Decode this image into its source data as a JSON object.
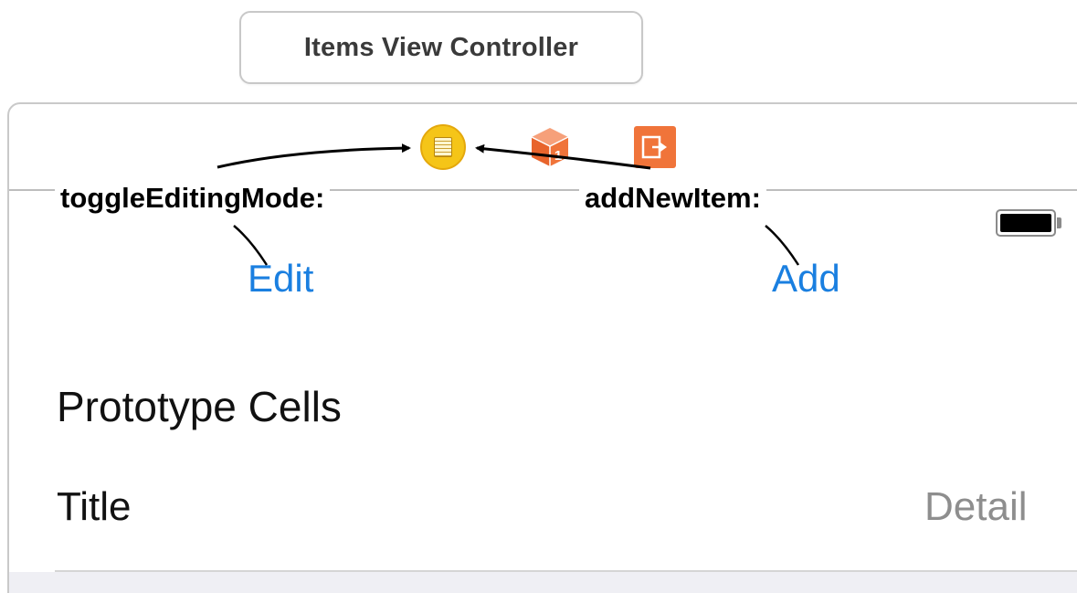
{
  "tooltip": {
    "text": "Items View Controller"
  },
  "scene_dock": {
    "icons": [
      "view-controller-icon",
      "first-responder-icon",
      "exit-icon"
    ],
    "colors": {
      "view_controller": "#f5c518",
      "first_responder": "#f0743a",
      "exit": "#f0743a"
    }
  },
  "connections": {
    "left_action": "toggleEditingMode:",
    "right_action": "addNewItem:"
  },
  "nav_bar": {
    "left_button": "Edit",
    "right_button": "Add",
    "tint_color": "#1a7fe0"
  },
  "status_bar": {
    "battery_icon": "battery-icon"
  },
  "table": {
    "section_header": "Prototype Cells",
    "cell": {
      "title": "Title",
      "detail": "Detail"
    }
  }
}
